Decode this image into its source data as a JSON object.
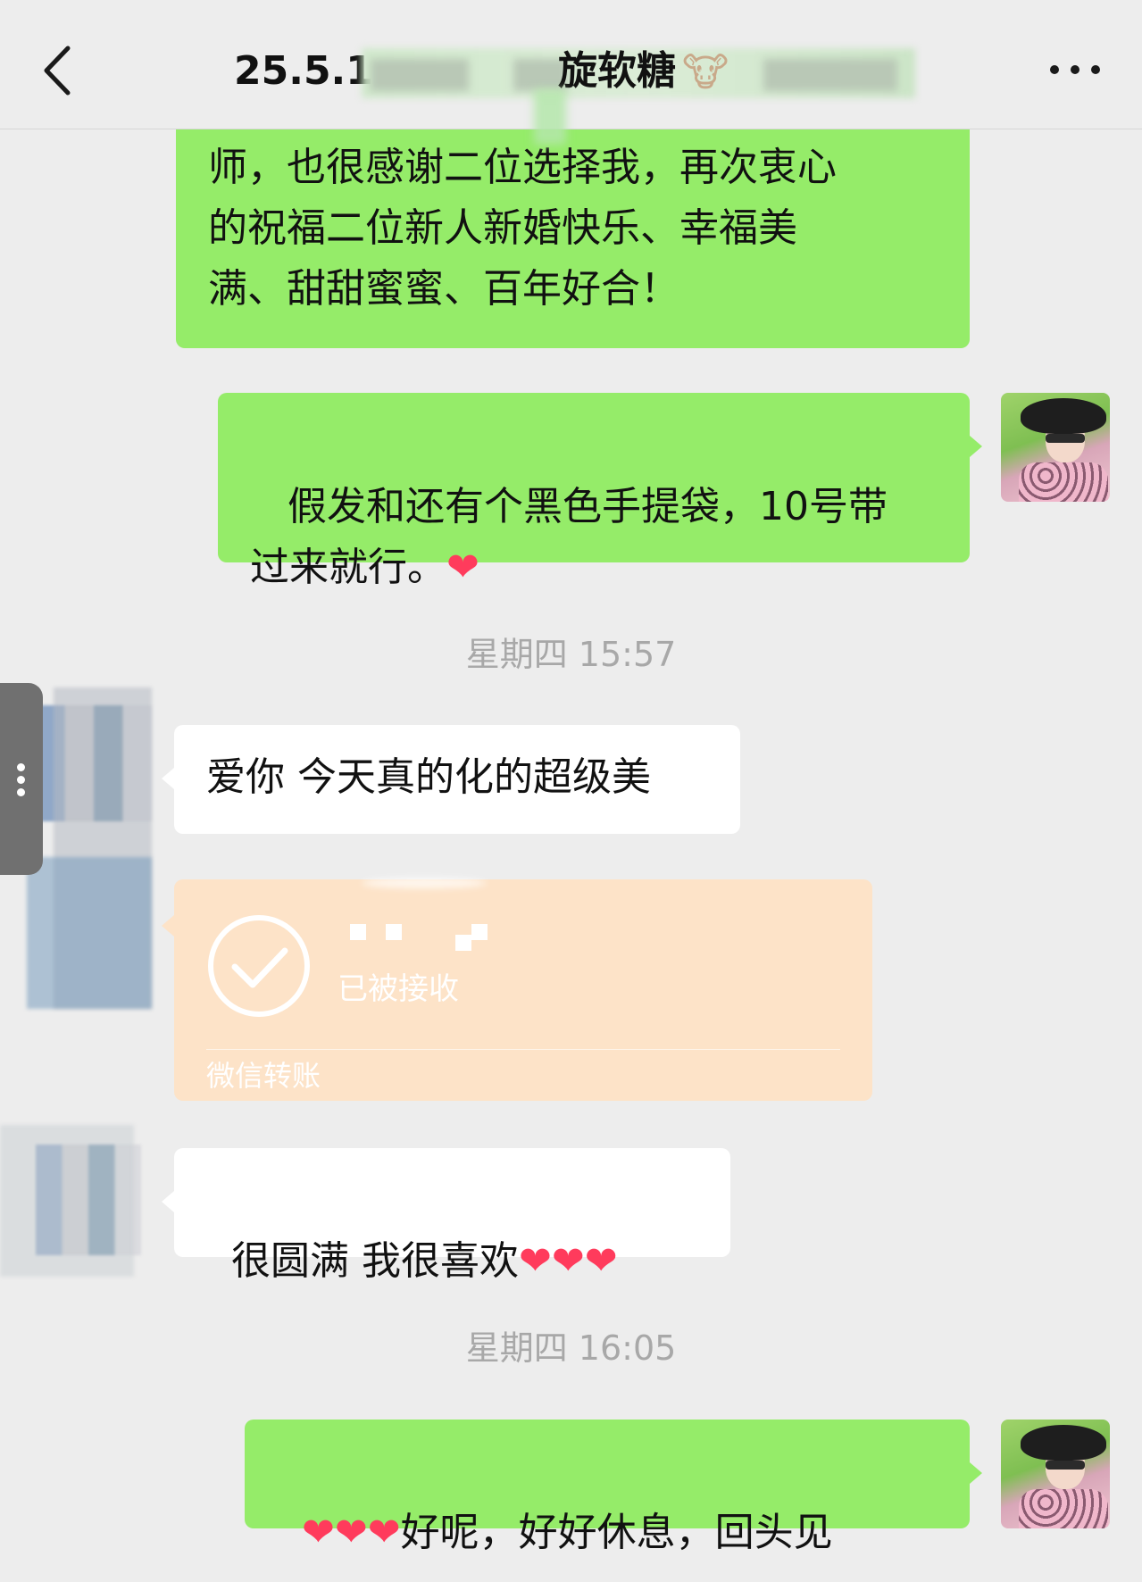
{
  "header": {
    "title_prefix": "25.5.1",
    "title_suffix": "旋软糖",
    "title_emoji": "🐮"
  },
  "messages": {
    "m1_text": "师，也很感谢二位选择我，再次衷心\n的祝福二位新人新婚快乐、幸福美\n满、甜甜蜜蜜、百年好合！",
    "m2_text": " 假发和还有个黑色手提袋，10号带\n过来就行。",
    "m2_heart": "❤",
    "ts1": "星期四 15:57",
    "m3_text": "爱你 今天真的化的超级美",
    "transfer": {
      "status": "已被接收",
      "label": "微信转账"
    },
    "m4_text": "很圆满 我很喜欢",
    "m4_hearts": "❤❤❤",
    "ts2": "星期四 16:05",
    "m5_hearts": "❤❤❤",
    "m5_text": "好呢，好好休息，回头见"
  },
  "colors": {
    "outgoing_bubble": "#95ec69",
    "incoming_bubble": "#ffffff",
    "transfer_card": "#fde3c8",
    "background": "#ededed"
  },
  "icons": [
    "back-chevron-icon",
    "more-dots-icon",
    "check-circle-icon",
    "side-handle-dots-icon"
  ]
}
